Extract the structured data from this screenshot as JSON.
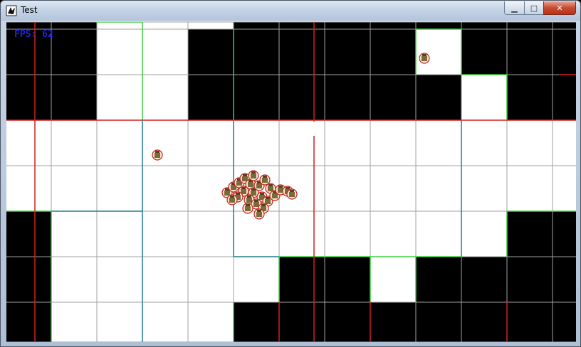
{
  "window": {
    "title": "Test",
    "controls": {
      "minimize": "▁",
      "maximize": "□",
      "close": "✕"
    },
    "colors": {
      "frame": "#b3c5dc",
      "close": "#c74a2f"
    }
  },
  "hud": {
    "fps_label": "FPS: 62"
  },
  "tilemap": {
    "columns": 13,
    "rows": 8,
    "colors": {
      "wall": "#000000",
      "floor": "#ffffff",
      "grid": "#a0a0a0",
      "edge_green": "#3ccf3c",
      "edge_teal": "#1f7f8f",
      "edge_red": "#d61f1f"
    },
    "tiles": [
      "WWFFWWWWWFWWW",
      "WWFFWWWWWWFWW",
      "FFFFFFFFFFFFF",
      "FFFFFFFFFFFFF",
      "WFFFFFFFFFFWW",
      "WFFFFFWWFWWWW",
      "WFFFFWWWWWWWW",
      "WWWWWWWWWWWWW"
    ]
  },
  "entities": {
    "cluster_count": 24,
    "lone_units": 2,
    "colors": {
      "unit_body": "#7a6a3a",
      "unit_ring": "#c82020",
      "unit_head": "#5a4020"
    }
  }
}
